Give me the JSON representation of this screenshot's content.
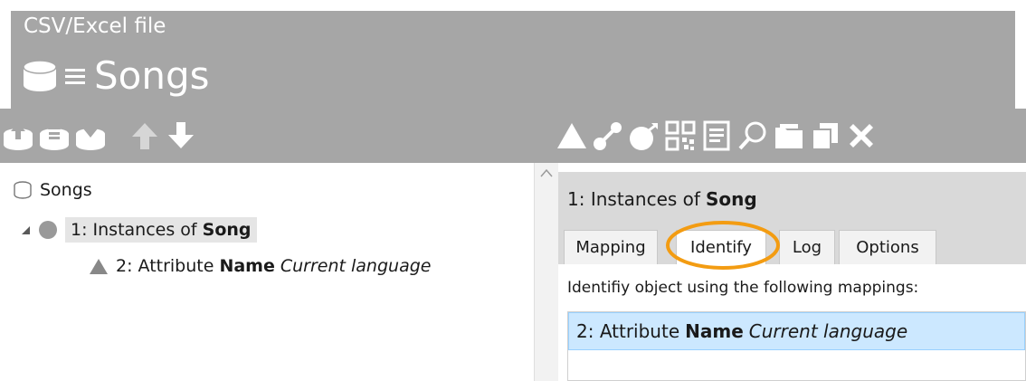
{
  "header": {
    "subtitle": "CSV/Excel file",
    "title": "Songs",
    "icons": [
      "database-icon",
      "lines-icon"
    ]
  },
  "toolbar": {
    "left_icons": [
      "import-icon",
      "refresh-icon",
      "export-icon",
      "move-up-icon",
      "move-down-icon"
    ],
    "right_icons": [
      "add-attribute-icon",
      "add-relation-icon",
      "add-instance-icon",
      "qr-code-icon",
      "document-icon",
      "search-icon",
      "folder-icon",
      "copy-icon",
      "delete-icon"
    ]
  },
  "tree": {
    "root": {
      "label": "Songs"
    },
    "instances": {
      "label": "1: Instances of",
      "label_bold": "Song"
    },
    "attribute": {
      "label": "2: Attribute",
      "label_bold": "Name",
      "label_italic": "Current language"
    }
  },
  "detail": {
    "header_text": "1: Instances of",
    "header_bold": "Song",
    "tabs": [
      "Mapping",
      "Identify",
      "Log",
      "Options"
    ],
    "active_tab": "Identify",
    "identify_prompt": "Identifiy object using the following mappings:",
    "mapping": {
      "label": "2: Attribute",
      "label_bold": "Name",
      "label_italic": "Current language"
    }
  },
  "colors": {
    "header_bg": "#a6a6a6",
    "panel_bg": "#d9d9d9",
    "selection_bg": "#cce8ff",
    "highlight": "#f39c12"
  }
}
